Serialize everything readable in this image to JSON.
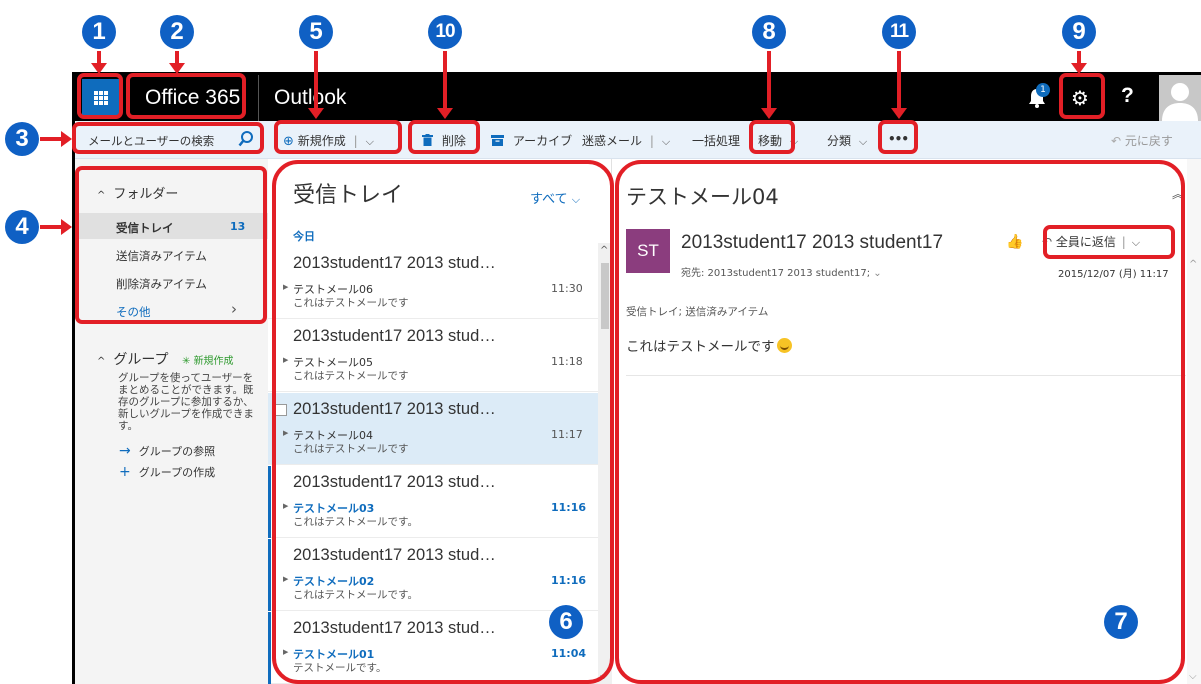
{
  "topbar": {
    "brand": "Office 365",
    "app": "Outlook",
    "notification_count": "1",
    "help_label": "?"
  },
  "commands": {
    "search_placeholder": "メールとユーザーの検索",
    "new": "新規作成",
    "delete": "削除",
    "archive": "アーカイブ",
    "junk": "迷惑メール",
    "sweep": "一括処理",
    "move": "移動",
    "categorize": "分類",
    "more": "•••",
    "undo": "元に戻す"
  },
  "nav": {
    "folders_header": "フォルダー",
    "folders": [
      {
        "label": "受信トレイ",
        "count": "13"
      },
      {
        "label": "送信済みアイテム"
      },
      {
        "label": "削除済みアイテム"
      }
    ],
    "more": "その他",
    "groups_header": "グループ",
    "groups_new": "新規作成",
    "groups_desc": "グループを使ってユーザーをまとめることができます。既存のグループに参加するか、新しいグループを作成できます。",
    "groups_browse": "グループの参照",
    "groups_create": "グループの作成"
  },
  "list": {
    "title": "受信トレイ",
    "filter": "すべて",
    "day": "今日",
    "messages": [
      {
        "from": "2013student17 2013 stud…",
        "subject": "テストメール06",
        "preview": "これはテストメールです",
        "time": "11:30"
      },
      {
        "from": "2013student17 2013 stud…",
        "subject": "テストメール05",
        "preview": "これはテストメールです",
        "time": "11:18"
      },
      {
        "from": "2013student17 2013 stud…",
        "subject": "テストメール04",
        "preview": "これはテストメールです",
        "time": "11:17"
      },
      {
        "from": "2013student17 2013 stud…",
        "subject": "テストメール03",
        "preview": "これはテストメールです。",
        "time": "11:16"
      },
      {
        "from": "2013student17 2013 stud…",
        "subject": "テストメール02",
        "preview": "これはテストメールです。",
        "time": "11:16"
      },
      {
        "from": "2013student17 2013 stud…",
        "subject": "テストメール01",
        "preview": "テストメールです。",
        "time": "11:04"
      }
    ]
  },
  "reading": {
    "subject": "テストメール04",
    "avatar_initials": "ST",
    "from": "2013student17 2013 student17",
    "to": "宛先: 2013student17 2013 student17;",
    "reply_all": "全員に返信",
    "date": "2015/12/07 (月) 11:17",
    "folders": "受信トレイ; 送信済みアイテム",
    "body": "これはテストメールです"
  },
  "callouts": [
    "1",
    "2",
    "3",
    "4",
    "5",
    "6",
    "7",
    "8",
    "9",
    "10",
    "11"
  ],
  "colors": {
    "accent": "#0f6cbd",
    "highlight": "#e21f26",
    "avatar": "#8b3d7e"
  }
}
